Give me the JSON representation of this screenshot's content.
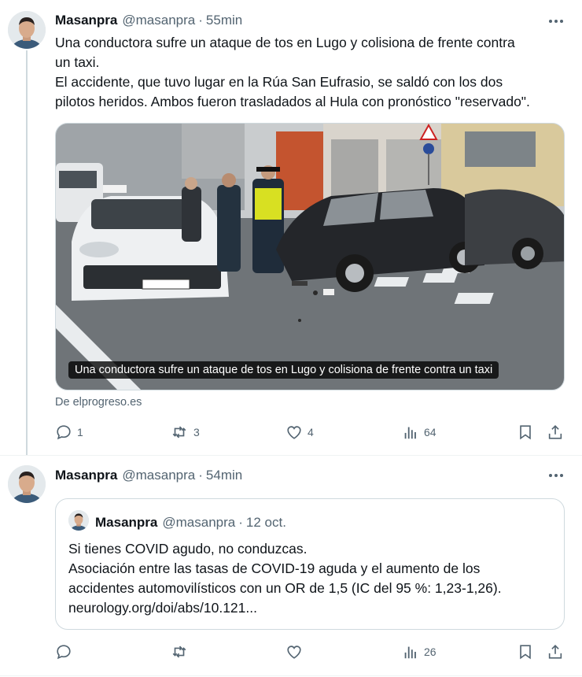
{
  "tweet1": {
    "name": "Masanpra",
    "handle": "@masanpra",
    "separator": "·",
    "time": "55min",
    "text_lines": [
      "Una conductora sufre un ataque de tos en Lugo y colisiona de frente contra",
      "un taxi.",
      "El accidente, que tuvo lugar en la Rúa San Eufrasio, se saldó con los dos",
      "pilotos heridos. Ambos fueron trasladados al Hula con pronóstico \"reservado\"."
    ],
    "media_caption": "Una conductora sufre un ataque de tos en Lugo y colisiona de frente contra un taxi",
    "source": "De elprogreso.es",
    "actions": {
      "reply_count": "1",
      "retweet_count": "3",
      "like_count": "4",
      "view_count": "64"
    }
  },
  "tweet2": {
    "name": "Masanpra",
    "handle": "@masanpra",
    "separator": "·",
    "time": "54min",
    "quote": {
      "name": "Masanpra",
      "handle": "@masanpra",
      "separator": "·",
      "time": "12 oct.",
      "text_lines": [
        "Si tienes COVID agudo, no conduzcas.",
        "Asociación entre las tasas de COVID-19 aguda y el aumento de los",
        "accidentes automovilísticos con un OR de 1,5 (IC del 95 %: 1,23-1,26).",
        "neurology.org/doi/abs/10.121..."
      ]
    },
    "actions": {
      "reply_count": "",
      "retweet_count": "",
      "like_count": "",
      "view_count": "26"
    }
  },
  "colors": {
    "text": "#0f1419",
    "secondary": "#536471",
    "border": "#cfd9de"
  },
  "icons": [
    "more-icon",
    "reply-icon",
    "retweet-icon",
    "like-icon",
    "views-icon",
    "bookmark-icon",
    "share-icon"
  ]
}
